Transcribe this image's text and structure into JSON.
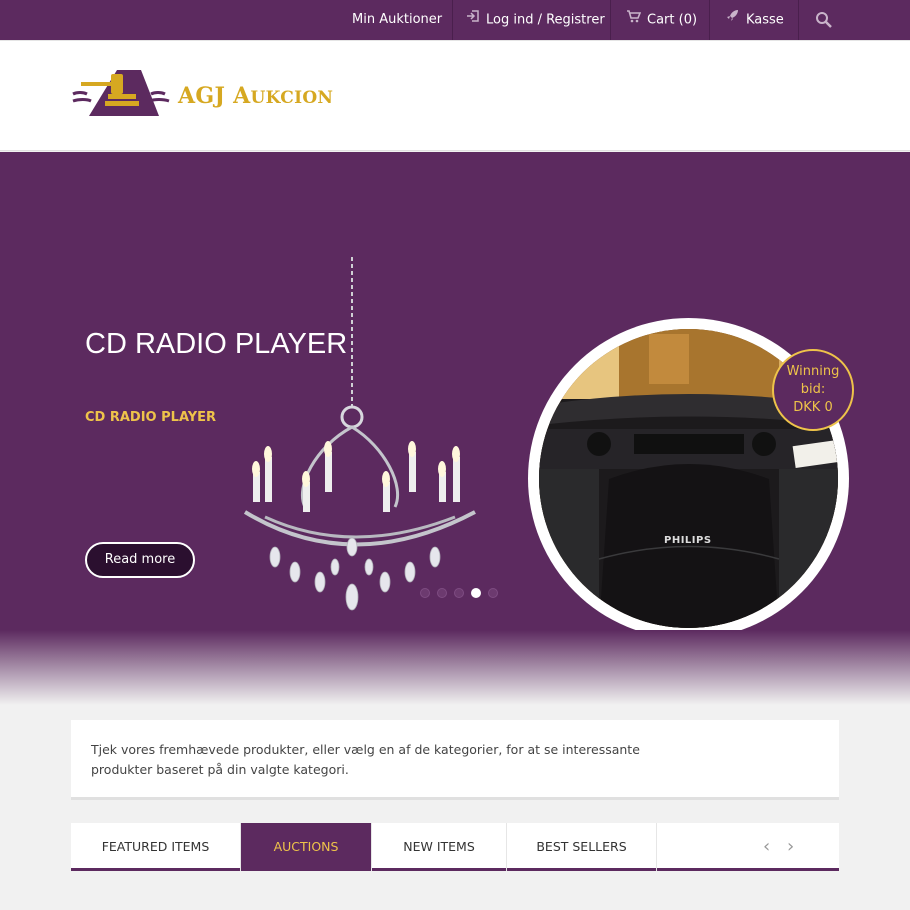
{
  "topbar": {
    "my_auctions": "Min Auktioner",
    "login": "Log ind / Registrer",
    "cart": "Cart (0)",
    "checkout": "Kasse"
  },
  "logo": {
    "text_main": "AGJ A",
    "text_small": "UKCION"
  },
  "hero": {
    "title": "CD RADIO PLAYER",
    "subtitle": "CD RADIO PLAYER",
    "read_more": "Read more",
    "badge_line1": "Winning",
    "badge_line2": "bid:",
    "badge_line3": "DKK 0",
    "brand_label": "PHILIPS",
    "slide_count": 5,
    "active_slide": 4
  },
  "info": {
    "line1": "Tjek vores fremhævede produkter, eller vælg en af de kategorier, for at se interessante",
    "line2": "produkter baseret på din valgte kategori."
  },
  "tabs": [
    "FEATURED ITEMS",
    "AUCTIONS",
    "NEW ITEMS",
    "BEST SELLERS"
  ],
  "active_tab": 1,
  "colors": {
    "brand": "#5c2a5f",
    "accent": "#eec34a",
    "gold": "#d6a821"
  }
}
